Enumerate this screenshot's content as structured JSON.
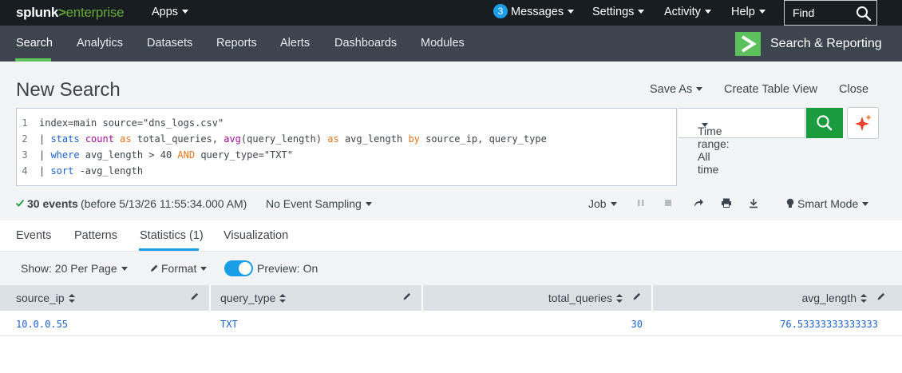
{
  "topbar": {
    "logo_splunk": "splunk",
    "logo_gt": ">",
    "logo_enterprise": "enterprise",
    "apps": "Apps",
    "messages_count": "3",
    "messages": "Messages",
    "settings": "Settings",
    "activity": "Activity",
    "help": "Help",
    "find_placeholder": "Find"
  },
  "appbar": {
    "nav": [
      "Search",
      "Analytics",
      "Datasets",
      "Reports",
      "Alerts",
      "Dashboards",
      "Modules"
    ],
    "active": "Search",
    "app_title": "Search & Reporting"
  },
  "header": {
    "title": "New Search",
    "save_as": "Save As",
    "create_table_view": "Create Table View",
    "close": "Close"
  },
  "editor": {
    "lines": [
      {
        "num": "1"
      },
      {
        "num": "2"
      },
      {
        "num": "3"
      },
      {
        "num": "4"
      }
    ],
    "line1": {
      "a": "index=main source=\"dns_logs.csv\""
    },
    "line2": {
      "pipe": "| ",
      "cmd": "stats",
      "s1": " ",
      "fn1": "count",
      "s2": " ",
      "as1": "as",
      "s3": " total_queries, ",
      "fn2": "avg",
      "s4": "(query_length) ",
      "as2": "as",
      "s5": " avg_length ",
      "by": "by",
      "s6": " source_ip, query_type"
    },
    "line3": {
      "pipe": "| ",
      "cmd": "where",
      "s1": " avg_length > 40 ",
      "and": "AND",
      "s2": " query_type=\"TXT\""
    },
    "line4": {
      "pipe": "| ",
      "cmd": "sort",
      "s1": " -avg_length"
    }
  },
  "time_range": "Time range: All time",
  "status": {
    "events_count": "30 events",
    "events_detail": "(before 5/13/26 11:55:34.000 AM)",
    "sampling": "No Event Sampling",
    "job": "Job",
    "mode": "Smart Mode"
  },
  "tabs": [
    "Events",
    "Patterns",
    "Statistics (1)",
    "Visualization"
  ],
  "active_tab": "Statistics (1)",
  "toolbar": {
    "per_page": "Show: 20 Per Page",
    "format": "Format",
    "preview": "Preview: On"
  },
  "table": {
    "columns": [
      "source_ip",
      "query_type",
      "total_queries",
      "avg_length"
    ],
    "rows": [
      [
        "10.0.0.55",
        "TXT",
        "30",
        "76.53333333333333"
      ]
    ]
  },
  "colors": {
    "topbar_bg": "#171d21",
    "appbar_bg": "#3c444d",
    "accent_green": "#5cc05c",
    "search_button": "#1a9c3e",
    "link_blue": "#1a62d2",
    "active_tab_blue": "#1a9ee8"
  }
}
